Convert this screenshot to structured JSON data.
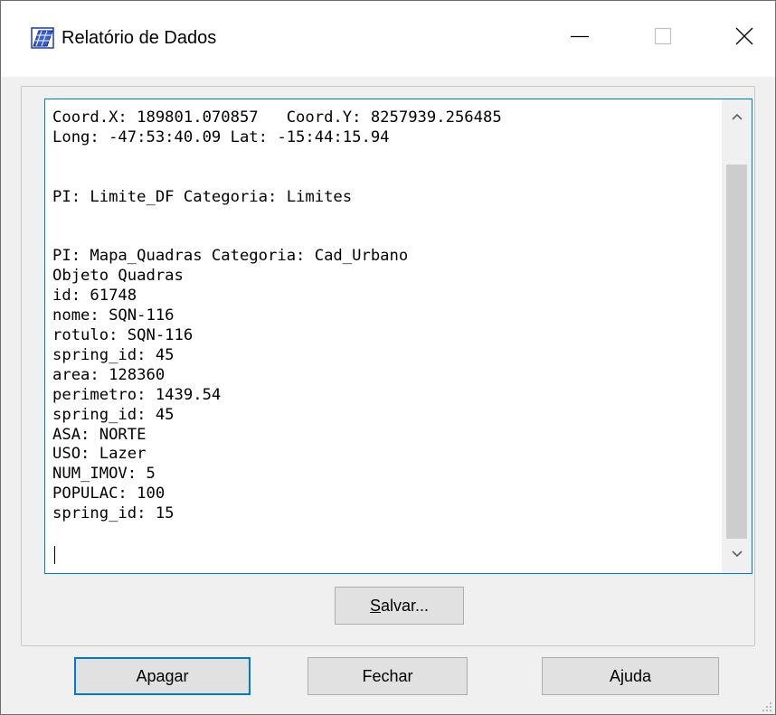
{
  "window": {
    "title": "Relatório de Dados"
  },
  "icons": {
    "app": "chart-grid-icon",
    "minimize": "minimize-icon",
    "maximize": "maximize-icon",
    "close": "close-icon"
  },
  "report": {
    "lines": [
      "Coord.X: 189801.070857   Coord.Y: 8257939.256485",
      "Long: -47:53:40.09 Lat: -15:44:15.94",
      "",
      "",
      "PI: Limite_DF Categoria: Limites",
      "",
      "",
      "PI: Mapa_Quadras Categoria: Cad_Urbano",
      "Objeto Quadras",
      "id: 61748",
      "nome: SQN-116",
      "rotulo: SQN-116",
      "spring_id: 45",
      "area: 128360",
      "perimetro: 1439.54",
      "spring_id: 45",
      "ASA: NORTE",
      "USO: Lazer",
      "NUM_IMOV: 5",
      "POPULAC: 100",
      "spring_id: 15"
    ]
  },
  "buttons": {
    "salvar_accel": "S",
    "salvar_rest": "alvar...",
    "apagar": "Apagar",
    "fechar": "Fechar",
    "ajuda": "Ajuda"
  },
  "colors": {
    "accent": "#0078d7",
    "button_face": "#e1e1e1",
    "dialog_bg": "#f0f0f0"
  }
}
